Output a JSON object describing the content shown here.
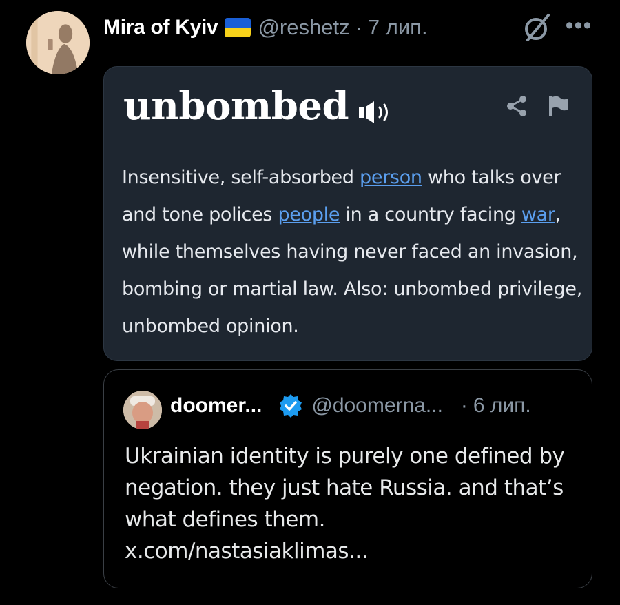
{
  "post": {
    "display_name": "Mira of Kyiv",
    "handle": "@reshetz",
    "separator": "·",
    "date": "7 лип.",
    "more_glyph": "•••",
    "flag_colors": [
      "#1a5fd6",
      "#f7d11a"
    ]
  },
  "definition_card": {
    "word": "unbombed",
    "icons": [
      "speaker-icon",
      "share-icon",
      "flag-icon"
    ],
    "text_parts": {
      "p1": "Insensitive, self-absorbed ",
      "link1": "person",
      "p2": " who talks over and tone polices ",
      "link2": "people",
      "p3": " in a country facing ",
      "link3": "war",
      "p4": ", while themselves having never faced an invasion, bombing or martial law. Also: unbombed privilege, unbombed opinion."
    },
    "link_color": "#5b9fef"
  },
  "quoted_post": {
    "display_name": "doomer...",
    "handle": "@doomerna...",
    "separator": "·",
    "date": "6 лип.",
    "text": "Ukrainian identity is purely one defined by negation. they just hate Russia. and that’s what defines them. x.com/nastasiaklimas..."
  }
}
